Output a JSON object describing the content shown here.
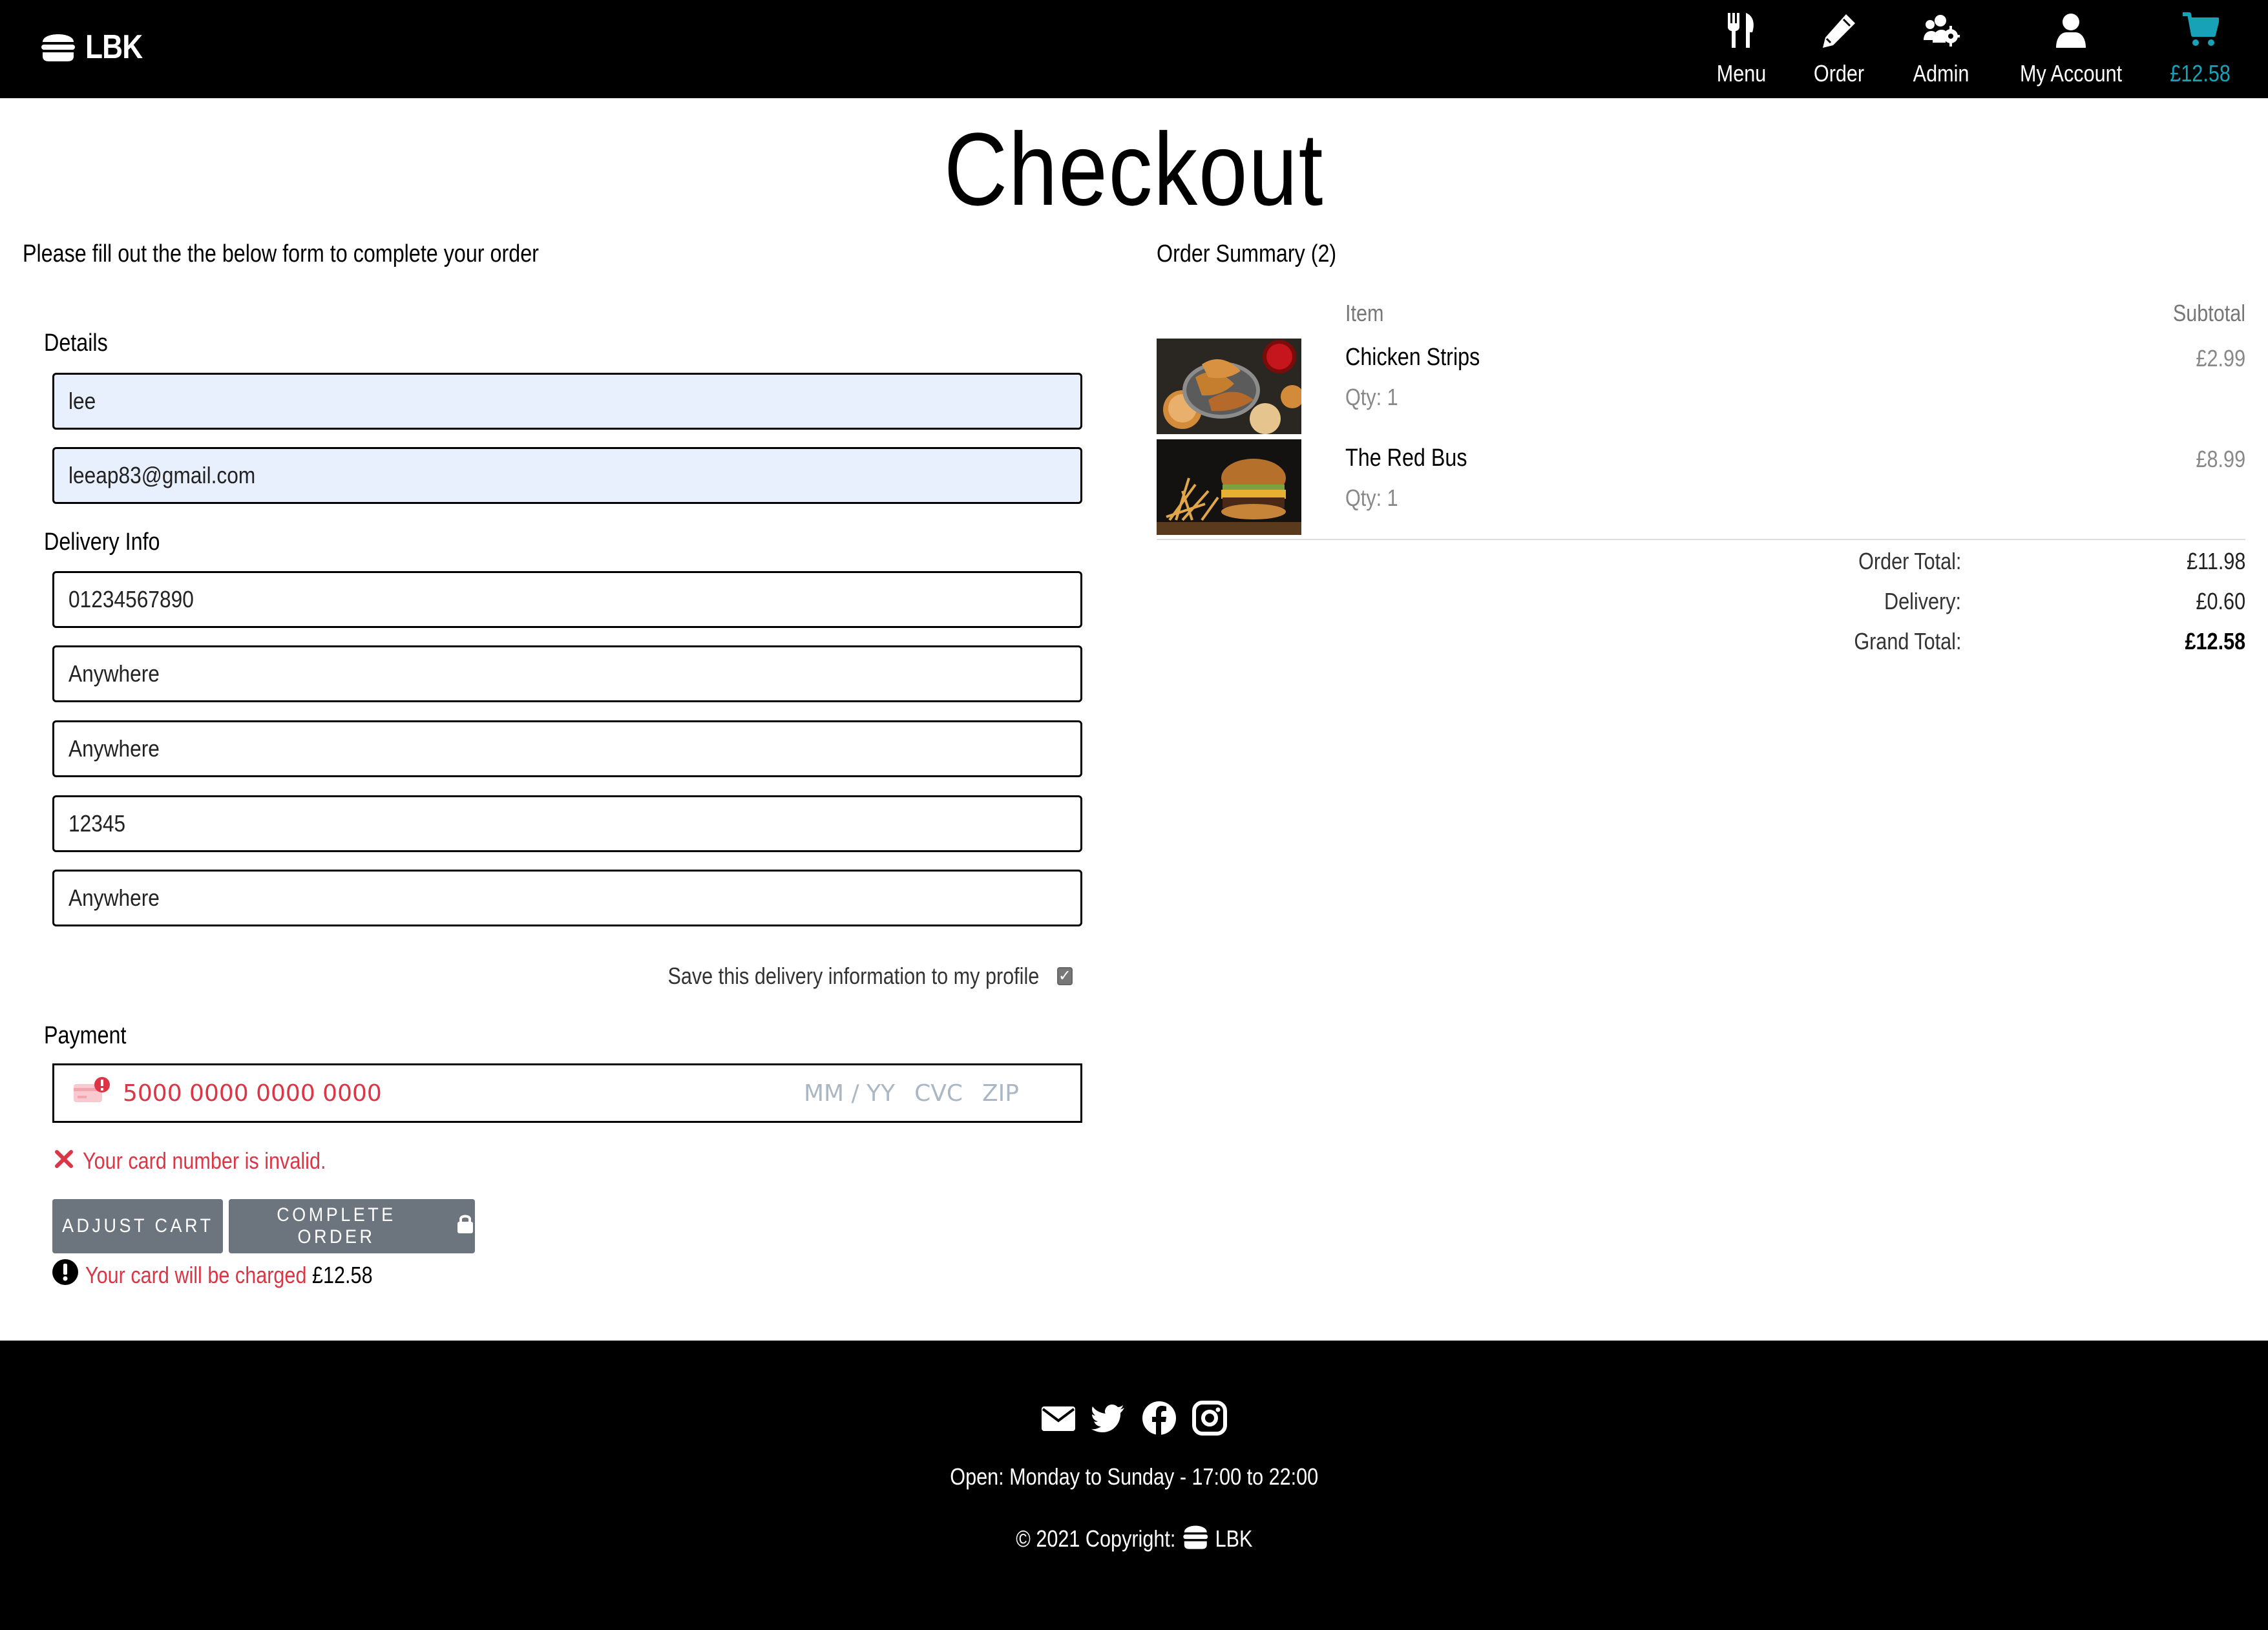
{
  "nav": {
    "brand": "LBK",
    "items": [
      {
        "label": "Menu",
        "icon": "utensils-icon"
      },
      {
        "label": "Order",
        "icon": "pencil-icon"
      },
      {
        "label": "Admin",
        "icon": "users-cog-icon"
      },
      {
        "label": "My Account",
        "icon": "user-icon"
      }
    ],
    "cart_total": "£12.58",
    "cart_color": "#17a2b8"
  },
  "page": {
    "title": "Checkout",
    "intro": "Please fill out the the below form to complete your order"
  },
  "form": {
    "details_label": "Details",
    "name": "lee",
    "email": "leeap83@gmail.com",
    "delivery_label": "Delivery Info",
    "phone": "01234567890",
    "address1": "Anywhere",
    "address2": "Anywhere",
    "postcode": "12345",
    "city": "Anywhere",
    "save_label": "Save this delivery information to my profile",
    "save_checked": true,
    "payment_label": "Payment",
    "card_number": "5000 0000 0000 0000",
    "card_expiry_placeholder": "MM / YY",
    "card_cvc_placeholder": "CVC",
    "card_zip_placeholder": "ZIP",
    "card_error": "Your card number is invalid.",
    "adjust_cart": "ADJUST CART",
    "complete_order": "COMPLETE ORDER",
    "charge_warning": "Your card will be charged",
    "charge_amount": "£12.58"
  },
  "summary": {
    "title": "Order Summary (2)",
    "col_item": "Item",
    "col_subtotal": "Subtotal",
    "items": [
      {
        "name": "Chicken Strips",
        "qty": "Qty: 1",
        "price": "£2.99"
      },
      {
        "name": "The Red Bus",
        "qty": "Qty: 1",
        "price": "£8.99"
      }
    ],
    "order_total_label": "Order Total:",
    "order_total": "£11.98",
    "delivery_label": "Delivery:",
    "delivery": "£0.60",
    "grand_total_label": "Grand Total:",
    "grand_total": "£12.58"
  },
  "footer": {
    "social": [
      "envelope-icon",
      "twitter-icon",
      "facebook-icon",
      "instagram-icon"
    ],
    "hours": "Open: Monday to Sunday - 17:00 to 22:00",
    "copyright": "© 2021 Copyright:",
    "brand": "LBK"
  },
  "colors": {
    "error": "#dc3545",
    "button": "#6c757d",
    "autofill": "#e8f0fe"
  }
}
